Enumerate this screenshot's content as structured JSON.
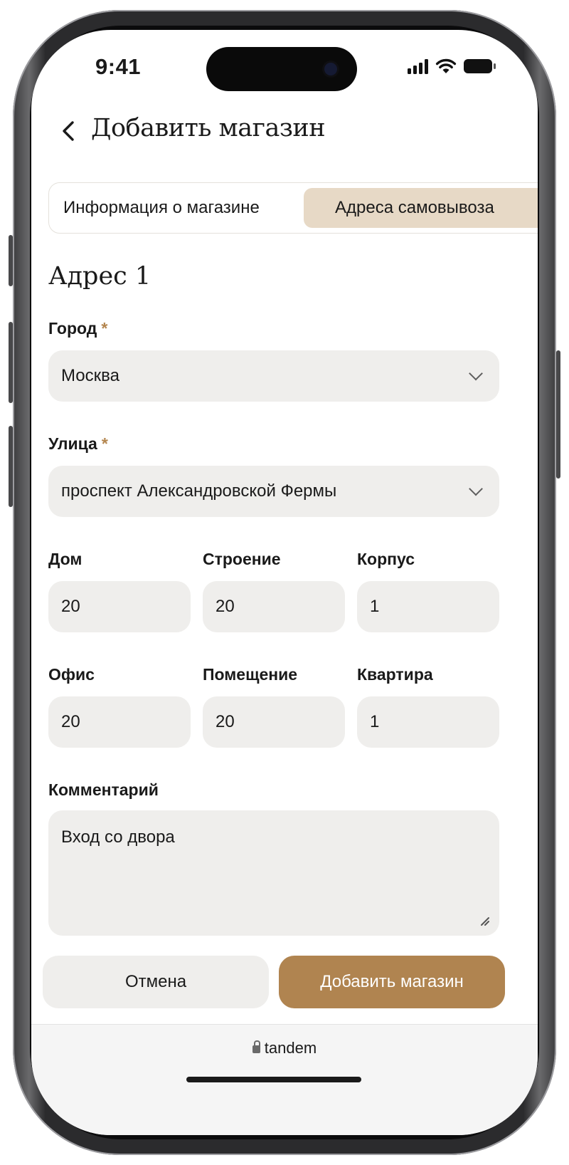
{
  "status_bar": {
    "time": "9:41"
  },
  "header": {
    "title": "Добавить магазин"
  },
  "tabs": [
    {
      "label": "Информация о магазине",
      "active": false
    },
    {
      "label": "Адреса самовывоза",
      "active": true
    }
  ],
  "section_title": "Адрес 1",
  "fields": {
    "city": {
      "label": "Город",
      "value": "Москва",
      "required": "*"
    },
    "street": {
      "label": "Улица",
      "value": "проспект Александровской Фермы",
      "required": "*"
    },
    "house": {
      "label": "Дом",
      "value": "20"
    },
    "building": {
      "label": "Строение",
      "value": "20"
    },
    "block": {
      "label": "Корпус",
      "value": "1"
    },
    "office": {
      "label": "Офис",
      "value": "20"
    },
    "room": {
      "label": "Помещение",
      "value": "20"
    },
    "apartment": {
      "label": "Квартира",
      "value": "1"
    },
    "comment": {
      "label": "Комментарий",
      "value": "Вход со двора"
    }
  },
  "buttons": {
    "cancel": "Отмена",
    "submit": "Добавить магазин"
  },
  "browser": {
    "url": "tandem"
  },
  "colors": {
    "accent": "#b08450",
    "active_tab": "#e7d9c6",
    "field_bg": "#efeeec",
    "required": "#b4864f"
  }
}
